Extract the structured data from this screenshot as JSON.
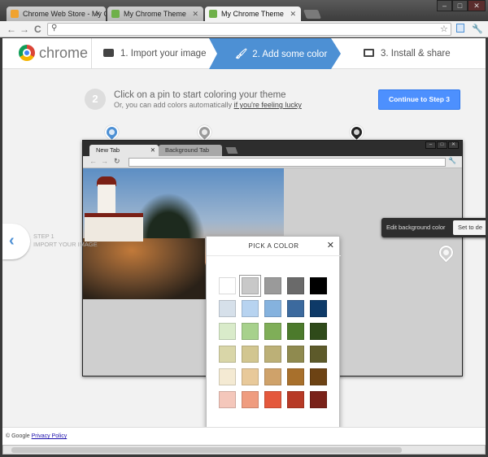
{
  "window": {
    "tabs": [
      {
        "label": "Chrome Web Store - My Ch",
        "active": false
      },
      {
        "label": "My Chrome Theme",
        "active": false
      },
      {
        "label": "My Chrome Theme",
        "active": true
      }
    ],
    "controls": {
      "minimize": "–",
      "maximize": "□",
      "close": "✕"
    }
  },
  "toolbar": {
    "back": "←",
    "forward": "→",
    "reload": "C"
  },
  "header": {
    "brand": "chrome",
    "steps": [
      {
        "label": "1. Import your image"
      },
      {
        "label": "2. Add some color"
      },
      {
        "label": "3. Install & share"
      }
    ]
  },
  "instructions": {
    "step_number": "2",
    "line1": "Click on a pin to start coloring your theme",
    "line2_prefix": "Or, you can add colors automatically",
    "line2_link": "if you're feeling lucky",
    "continue_label": "Continue to Step 3"
  },
  "prev": {
    "line1": "STEP 1",
    "line2": "IMPORT YOUR IMAGE"
  },
  "mock": {
    "tab1": "New Tab",
    "tab2": "Background Tab",
    "tooltip_text": "Edit background color",
    "tooltip_button": "Set to de"
  },
  "picker": {
    "title": "PICK A COLOR",
    "close": "✕",
    "swatches": [
      [
        "#ffffff",
        "#c8c8c8",
        "#9a9a9a",
        "#6a6a6a",
        "#000000"
      ],
      [
        "#d6e0ea",
        "#b7d3f0",
        "#85b2de",
        "#3c6a9e",
        "#0e3a68"
      ],
      [
        "#d9ebca",
        "#a7d18c",
        "#7fae58",
        "#4c7a2c",
        "#2f4a1a"
      ],
      [
        "#d9d6a8",
        "#d2c690",
        "#bcb077",
        "#8f8a4f",
        "#5d5a2a"
      ],
      [
        "#f4ead3",
        "#e8c99a",
        "#cfa26a",
        "#a8702c",
        "#6d4314"
      ],
      [
        "#f4c7bb",
        "#ef9c7f",
        "#e4583c",
        "#b73a26",
        "#7a2219"
      ]
    ],
    "selected_swatch": "#c8c8c8"
  },
  "footer": {
    "prefix": "© Google",
    "link": "Privacy Policy"
  },
  "colors": {
    "accent": "#4d90d4",
    "cta": "#4d90fe",
    "pin_blue": "#4d90d4",
    "pin_gray": "#9a9a9a",
    "pin_dark": "#222222"
  }
}
